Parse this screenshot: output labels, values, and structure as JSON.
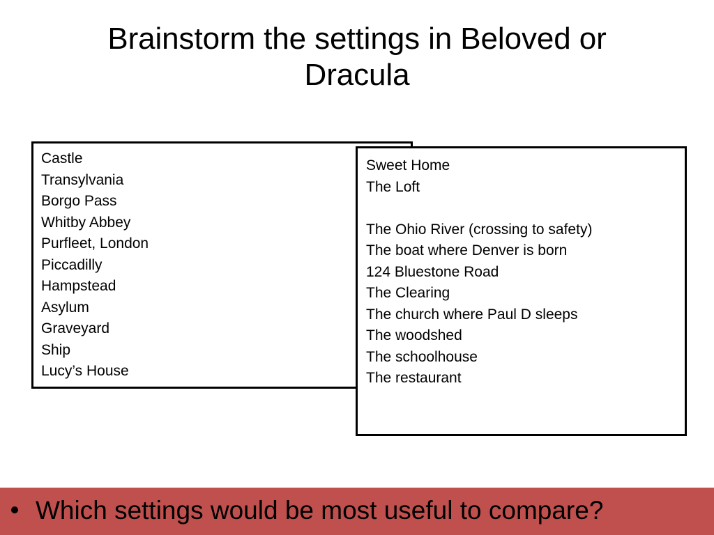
{
  "slide": {
    "title_line1": "Brainstorm the settings in Beloved or",
    "title_line2": "Dracula",
    "left_box": {
      "items": [
        "Castle",
        "Transylvania",
        "Borgo Pass",
        "Whitby Abbey",
        "Purfleet, London",
        "Piccadilly",
        "Hampstead",
        "Asylum",
        "Graveyard",
        "Ship",
        "Lucy’s House"
      ]
    },
    "right_box": {
      "items": [
        "Sweet Home",
        "The Loft",
        "",
        "The Ohio River (crossing to safety)",
        "The boat where Denver is born",
        "124 Bluestone Road",
        "The Clearing",
        "The church where Paul D sleeps",
        "The woodshed",
        "The schoolhouse",
        "The restaurant"
      ]
    },
    "banner": {
      "bullet_text": "Which settings would be most useful to compare?",
      "background_color": "#C0504D",
      "text_color": "#000000"
    },
    "colors": {
      "page_background": "#FFFFFF",
      "box_border": "#000000",
      "body_text": "#000000",
      "accent_red": "#C0504D"
    }
  }
}
